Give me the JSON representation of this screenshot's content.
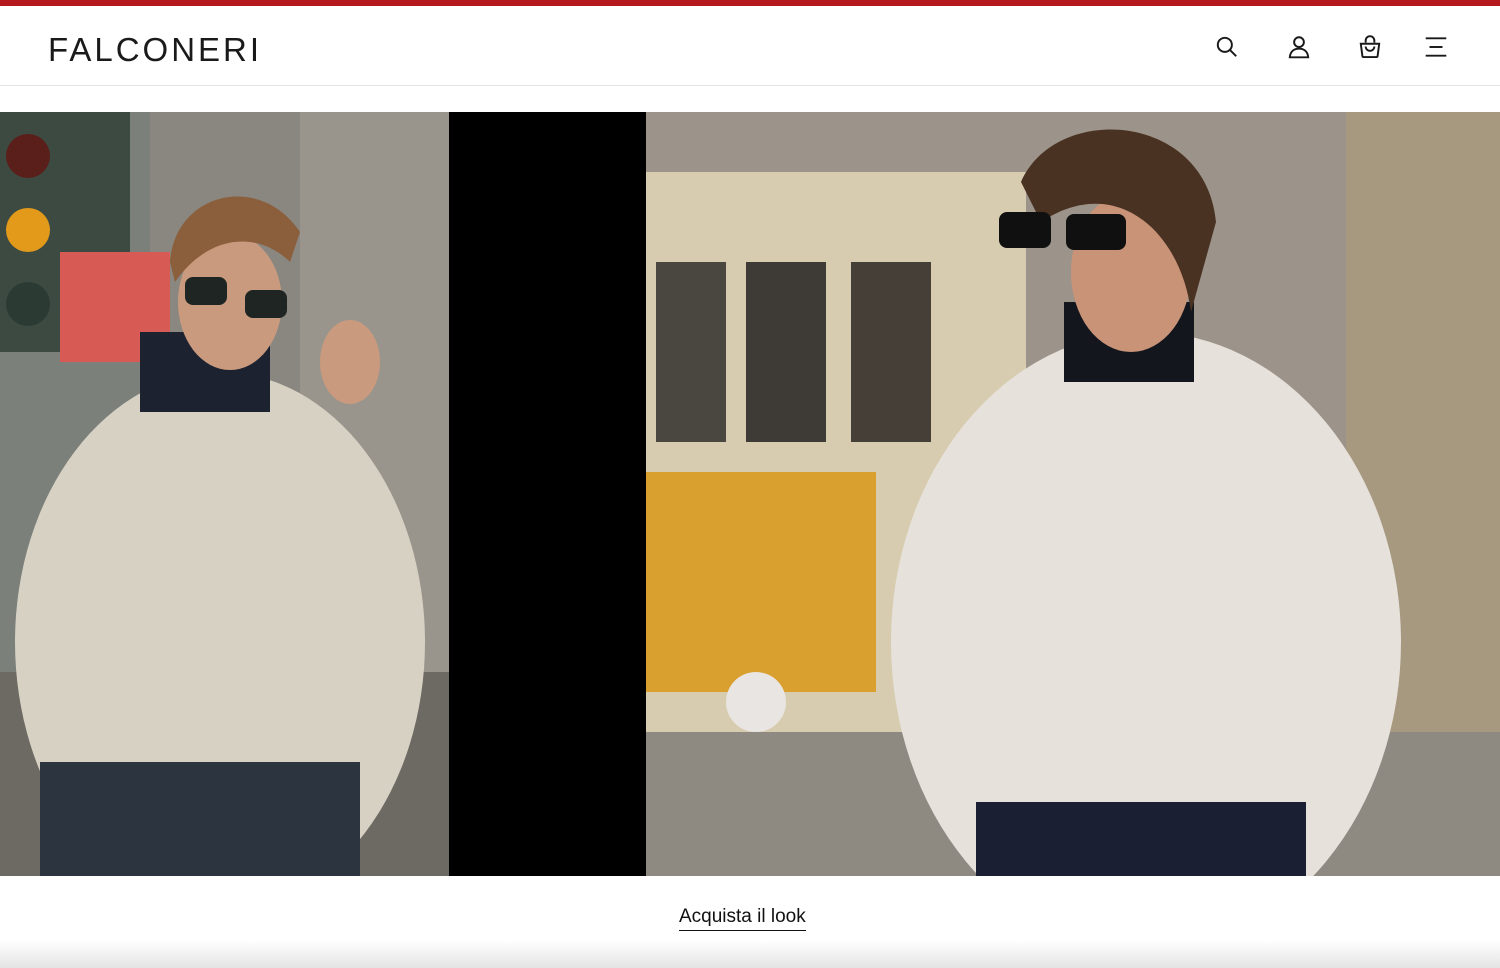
{
  "brand": {
    "logo_text": "FALCONERI",
    "accent_color": "#b5191d"
  },
  "header": {
    "icons": {
      "search": "search-icon",
      "account": "user-icon",
      "bag": "shopping-bag-icon",
      "menu": "hamburger-menu-icon"
    }
  },
  "hero": {
    "left_image": "man in cream crewneck sweater over navy turtleneck adjusting sunglasses",
    "right_image": "man in cream crewneck sweater over navy turtleneck with sunglasses, tram in background"
  },
  "cta": {
    "label": "Acquista il look"
  }
}
